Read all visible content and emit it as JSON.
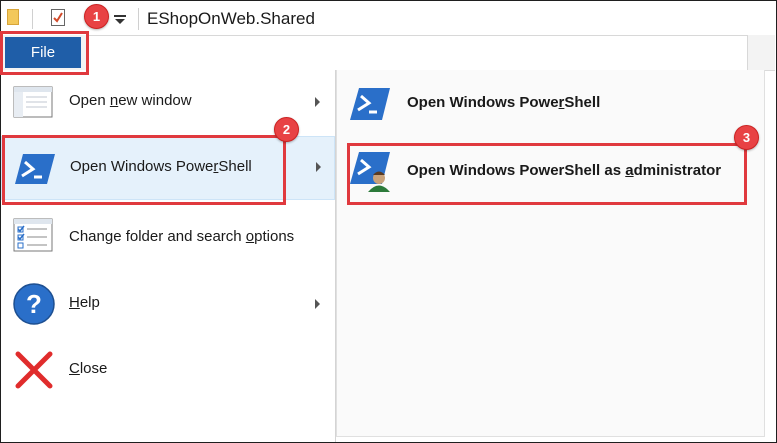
{
  "window": {
    "title": "EShopOnWeb.Shared"
  },
  "ribbon": {
    "file_tab": "File"
  },
  "menu": {
    "items": [
      {
        "name": "open-new-window",
        "pre": "Open ",
        "accel": "n",
        "post": "ew window",
        "icon": "window-icon",
        "has_submenu": true
      },
      {
        "name": "open-powershell",
        "pre": "Open Windows Powe",
        "accel": "r",
        "post": "Shell",
        "icon": "powershell-icon",
        "has_submenu": true
      },
      {
        "name": "change-folder-options",
        "pre": "Change folder and search ",
        "accel": "o",
        "post": "ptions",
        "icon": "options-icon",
        "has_submenu": false
      },
      {
        "name": "help",
        "pre": "",
        "accel": "H",
        "post": "elp",
        "icon": "help-icon",
        "has_submenu": true
      },
      {
        "name": "close",
        "pre": "",
        "accel": "C",
        "post": "lose",
        "icon": "close-icon",
        "has_submenu": false
      }
    ]
  },
  "submenu": {
    "items": [
      {
        "name": "open-powershell-sub",
        "pre": "Open Windows Powe",
        "accel": "r",
        "post": "Shell",
        "icon": "powershell-icon"
      },
      {
        "name": "open-powershell-admin",
        "pre": "Open Windows PowerShell as ",
        "accel": "a",
        "post": "dministrator",
        "icon": "powershell-admin-icon"
      }
    ]
  },
  "callouts": [
    {
      "number": "1"
    },
    {
      "number": "2"
    },
    {
      "number": "3"
    }
  ],
  "colors": {
    "accent": "#1f5ea8",
    "callout": "#e0393e",
    "hover": "#e5f1fb"
  }
}
